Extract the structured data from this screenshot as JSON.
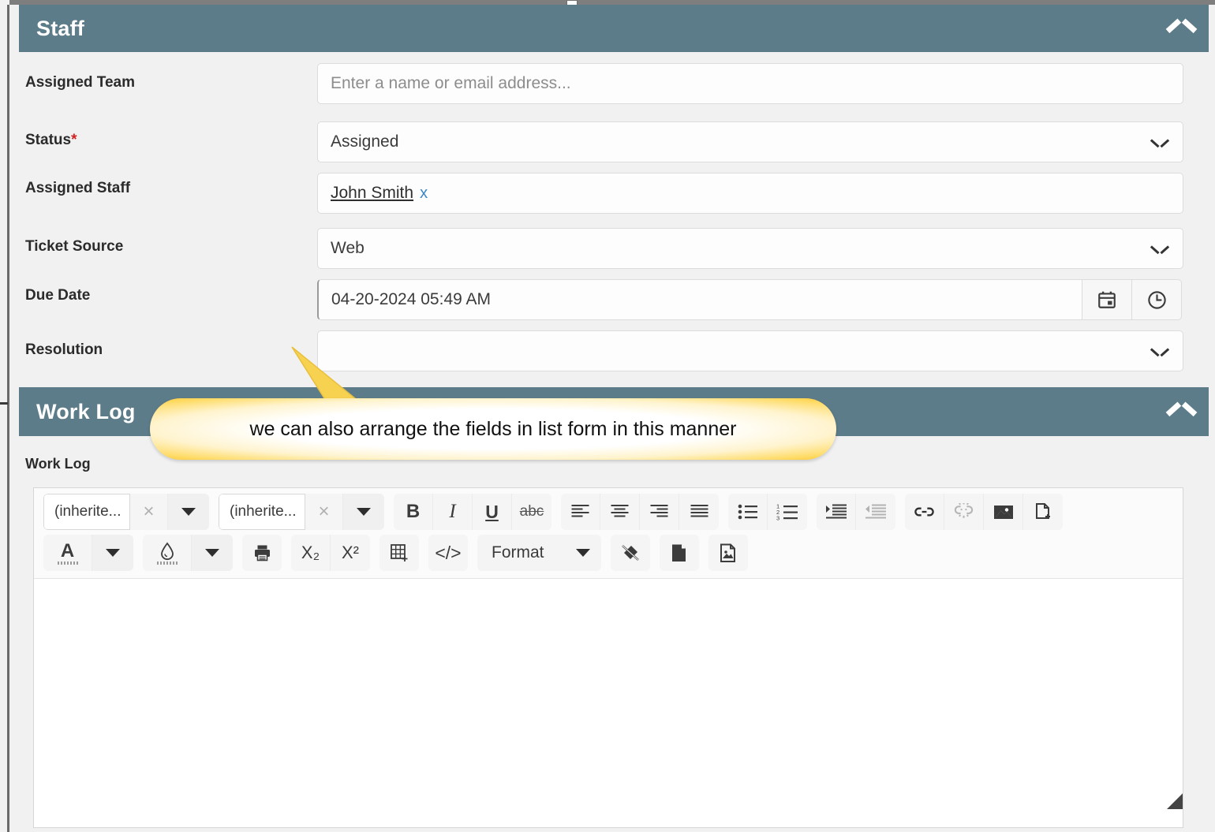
{
  "theme": {
    "panel_header_bg": "#5d7c8a",
    "page_bg": "#f1f1f1",
    "required_star": "#d32020",
    "link_blue": "#3d86c6",
    "callout_border": "#f5c63c"
  },
  "panels": {
    "staff": {
      "title": "Staff",
      "collapse_icon": "chevron-up-icon",
      "fields": [
        {
          "label": "Assigned Team",
          "required": false,
          "type": "text",
          "value": "",
          "placeholder": "Enter a name or email address..."
        },
        {
          "label": "Status",
          "required": true,
          "required_mark": "*",
          "type": "select",
          "value": "Assigned",
          "placeholder": ""
        },
        {
          "label": "Assigned Staff",
          "required": false,
          "type": "token",
          "value": "John Smith",
          "remove_label": "x"
        },
        {
          "label": "Ticket Source",
          "required": false,
          "type": "select",
          "value": "Web",
          "placeholder": ""
        },
        {
          "label": "Due Date",
          "required": false,
          "type": "datetime",
          "value": "04-20-2024 05:49 AM",
          "calendar_icon": "calendar-icon",
          "clock_icon": "clock-icon"
        },
        {
          "label": "Resolution",
          "required": false,
          "type": "select",
          "value": "",
          "placeholder": ""
        }
      ]
    },
    "work_log": {
      "title": "Work Log",
      "collapse_icon": "chevron-up-icon",
      "sublabel": "Work Log",
      "editor": {
        "content": "",
        "toolbar_row1": [
          {
            "name": "font-family-combo",
            "value": "(inherite...",
            "clear_label": "×",
            "caret": "▼"
          },
          {
            "name": "font-size-combo",
            "value": "(inherite...",
            "clear_label": "×",
            "caret": "▼"
          },
          {
            "name": "bold-button",
            "label": "B"
          },
          {
            "name": "italic-button",
            "label": "I"
          },
          {
            "name": "underline-button",
            "label": "U"
          },
          {
            "name": "strikethrough-button",
            "label": "abc"
          },
          {
            "name": "align-left-button",
            "label": ""
          },
          {
            "name": "align-center-button",
            "label": ""
          },
          {
            "name": "align-right-button",
            "label": ""
          },
          {
            "name": "align-justify-button",
            "label": ""
          },
          {
            "name": "bulleted-list-button",
            "label": ""
          },
          {
            "name": "numbered-list-button",
            "label": ""
          },
          {
            "name": "increase-indent-button",
            "label": ""
          },
          {
            "name": "decrease-indent-button",
            "label": ""
          },
          {
            "name": "insert-link-button",
            "label": ""
          },
          {
            "name": "remove-link-button",
            "label": ""
          },
          {
            "name": "insert-image-button",
            "label": ""
          },
          {
            "name": "insert-file-button",
            "label": ""
          }
        ],
        "toolbar_row2": [
          {
            "name": "text-color-button",
            "label": "A",
            "caret": "▼"
          },
          {
            "name": "highlight-color-button",
            "label": "",
            "caret": "▼"
          },
          {
            "name": "print-button",
            "label": ""
          },
          {
            "name": "subscript-button",
            "label": "X₂"
          },
          {
            "name": "superscript-button",
            "label": "X²"
          },
          {
            "name": "insert-table-button",
            "label": ""
          },
          {
            "name": "source-code-button",
            "label": "</>"
          },
          {
            "name": "format-dropdown",
            "label": "Format",
            "caret": "▼"
          },
          {
            "name": "clear-formatting-button",
            "label": ""
          },
          {
            "name": "insert-document-button",
            "label": ""
          },
          {
            "name": "insert-media-button",
            "label": ""
          }
        ]
      }
    }
  },
  "callout": {
    "text": "we can also arrange the fields in list form in this manner"
  }
}
